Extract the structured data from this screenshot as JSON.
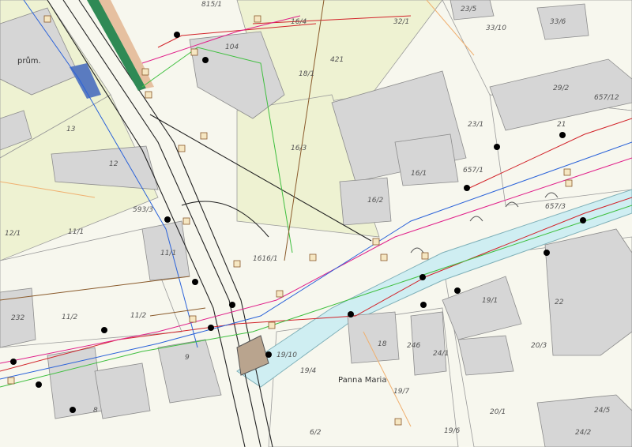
{
  "colors": {
    "parcel_green": "#eef2d2",
    "parcel_white": "#f7f7ee",
    "building": "#d6d6d6",
    "building_stroke": "#8c8c8c",
    "water": "#cfeef2",
    "water_stroke": "#7fb0b8",
    "road": "#222222",
    "util_red": "#d2232a",
    "util_magenta": "#e0208a",
    "util_blue": "#2a62d9",
    "util_green": "#3fbf3f",
    "util_brown": "#8a5a2b",
    "util_orange": "#f0b070"
  },
  "labels": {
    "l_815_1": "815/1",
    "l_16_4": "16/4",
    "l_32_1": "32/1",
    "l_23_5": "23/5",
    "l_33_10": "33/10",
    "l_33_6": "33/6",
    "l_prum": "prům.",
    "l_10_4": "104",
    "l_421": "421",
    "l_18_1": "18/1",
    "l_29_2": "29/2",
    "l_657_12": "657/12",
    "l_13": "13",
    "l_23_1": "23/1",
    "l_21": "21",
    "l_16_3": "16/3",
    "l_12": "12",
    "l_16_1": "16/1",
    "l_657_1": "657/1",
    "l_16_2": "16/2",
    "l_657_3": "657/3",
    "l_12_1": "12/1",
    "l_11_1": "11/1",
    "l_593": "593/3",
    "l_11_1b": "11/1",
    "l_1616": "1616/1",
    "l_232": "232",
    "l_11_2": "11/2",
    "l_19_1": "19/1",
    "l_22": "22",
    "l_9": "9",
    "l_19_10": "19/10",
    "l_18": "18",
    "l_246": "246",
    "l_24_1": "24/1",
    "l_20_3": "20/3",
    "l_19_4": "19/4",
    "l_19_7": "19/7",
    "l_19_6": "19/6",
    "l_20_1": "20/1",
    "l_24_5": "24/5",
    "l_24_2": "24/2",
    "l_8": "8",
    "l_6_2": "6/2",
    "l_panna": "Panna Maria"
  }
}
